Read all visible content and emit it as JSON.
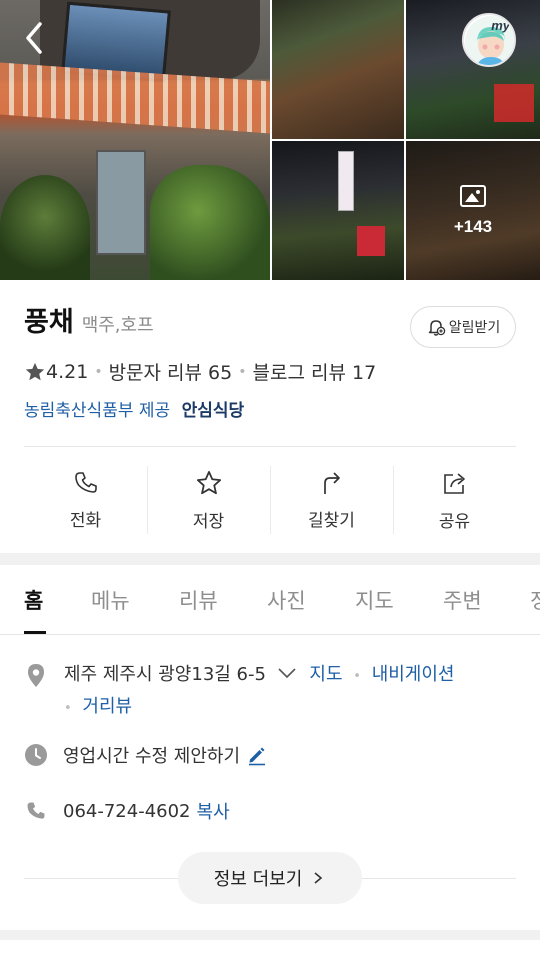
{
  "place": {
    "name": "풍채",
    "category": "맥주,호프",
    "rating": "4.21",
    "visitor_reviews": "방문자 리뷰 65",
    "blog_reviews": "블로그 리뷰 17",
    "provider": "농림축산식품부 제공",
    "badge": "안심식당"
  },
  "header": {
    "alarm_label": "알림받기",
    "avatar_text": "my"
  },
  "gallery": {
    "more_count": "+143"
  },
  "actions": [
    {
      "label": "전화",
      "icon": "phone-icon"
    },
    {
      "label": "저장",
      "icon": "star-icon"
    },
    {
      "label": "길찾기",
      "icon": "directions-icon"
    },
    {
      "label": "공유",
      "icon": "share-icon"
    }
  ],
  "tabs": [
    "홈",
    "메뉴",
    "리뷰",
    "사진",
    "지도",
    "주변",
    "정"
  ],
  "active_tab": "홈",
  "address": {
    "text": "제주 제주시 광양13길 6-5",
    "map_link": "지도",
    "navigation_link": "내비게이션",
    "street_view_link": "거리뷰"
  },
  "hours": {
    "text": "영업시간 수정 제안하기"
  },
  "phone": {
    "number": "064-724-4602",
    "copy_label": "복사"
  },
  "more_info_label": "정보 더보기",
  "colors": {
    "link": "#1f5fa6",
    "badge": "#1c3a66",
    "muted": "#8e8e8e"
  }
}
